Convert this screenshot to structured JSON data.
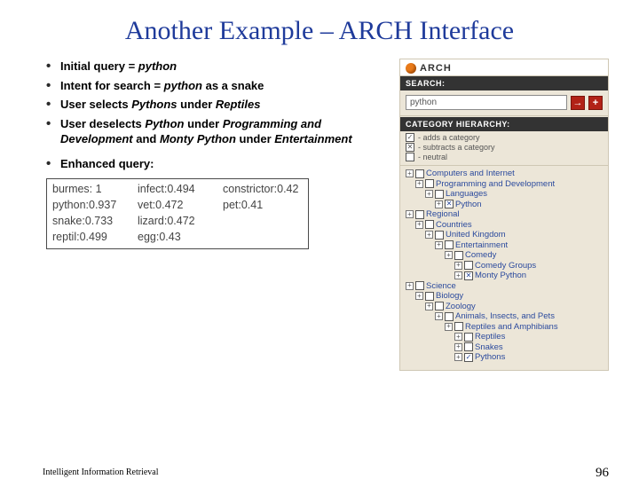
{
  "title": "Another Example – ARCH Interface",
  "bullets": {
    "b1_pre": "Initial query = ",
    "b1_em": "python",
    "b2_pre": "Intent for search = ",
    "b2_em": "python ",
    "b2_post": "as a snake",
    "b3_pre": "User selects ",
    "b3_em1": "Pythons ",
    "b3_mid": "under ",
    "b3_em2": "Reptiles",
    "b4_pre": "User deselects ",
    "b4_em1": "Python ",
    "b4_mid1": "under ",
    "b4_em2": "Programming and Development",
    "b4_mid2": " and ",
    "b4_em3": "Monty Python ",
    "b4_mid3": "under ",
    "b4_em4": "Entertainment",
    "b5": "Enhanced query:"
  },
  "enhanced": [
    "burmes: 1",
    "infect:0.494",
    "constrictor:0.42",
    "python:0.937",
    "vet:0.472",
    "pet:0.41",
    "snake:0.733",
    "lizard:0.472",
    "",
    "reptil:0.499",
    "egg:0.43",
    ""
  ],
  "panel": {
    "brand": "ARCH",
    "search_header": "SEARCH:",
    "search_value": "python",
    "go_glyph": "→",
    "plus_glyph": "+",
    "cat_header": "CATEGORY HIERARCHY:",
    "legend": {
      "add_mark": "✓",
      "add_text": "- adds a category",
      "sub_mark": "✕",
      "sub_text": "- subtracts a category",
      "neu_mark": "",
      "neu_text": "- neutral"
    },
    "tree": [
      {
        "depth": 1,
        "exp": "+",
        "cb": "",
        "label": "Computers and Internet"
      },
      {
        "depth": 2,
        "exp": "+",
        "cb": "",
        "label": "Programming and Development"
      },
      {
        "depth": 3,
        "exp": "+",
        "cb": "",
        "label": "Languages"
      },
      {
        "depth": 4,
        "exp": "+",
        "cb": "✕",
        "label": "Python"
      },
      {
        "depth": 1,
        "exp": "+",
        "cb": "",
        "label": "Regional"
      },
      {
        "depth": 2,
        "exp": "+",
        "cb": "",
        "label": "Countries"
      },
      {
        "depth": 3,
        "exp": "+",
        "cb": "",
        "label": "United Kingdom"
      },
      {
        "depth": 4,
        "exp": "+",
        "cb": "",
        "label": "Entertainment"
      },
      {
        "depth": 5,
        "exp": "+",
        "cb": "",
        "label": "Comedy"
      },
      {
        "depth": 6,
        "exp": "+",
        "cb": "",
        "label": "Comedy Groups"
      },
      {
        "depth": 6,
        "exp": "+",
        "cb": "✕",
        "label": "Monty Python"
      },
      {
        "depth": 1,
        "exp": "+",
        "cb": "",
        "label": "Science"
      },
      {
        "depth": 2,
        "exp": "+",
        "cb": "",
        "label": "Biology"
      },
      {
        "depth": 3,
        "exp": "+",
        "cb": "",
        "label": "Zoology"
      },
      {
        "depth": 4,
        "exp": "+",
        "cb": "",
        "label": "Animals, Insects, and Pets"
      },
      {
        "depth": 5,
        "exp": "+",
        "cb": "",
        "label": "Reptiles and Amphibians"
      },
      {
        "depth": 6,
        "exp": "+",
        "cb": "",
        "label": "Reptiles"
      },
      {
        "depth": 6,
        "exp": "+",
        "cb": "",
        "label": "Snakes"
      },
      {
        "depth": 6,
        "exp": "+",
        "cb": "✓",
        "label": "Pythons"
      }
    ]
  },
  "footer_left": "Intelligent Information Retrieval",
  "footer_right": "96"
}
